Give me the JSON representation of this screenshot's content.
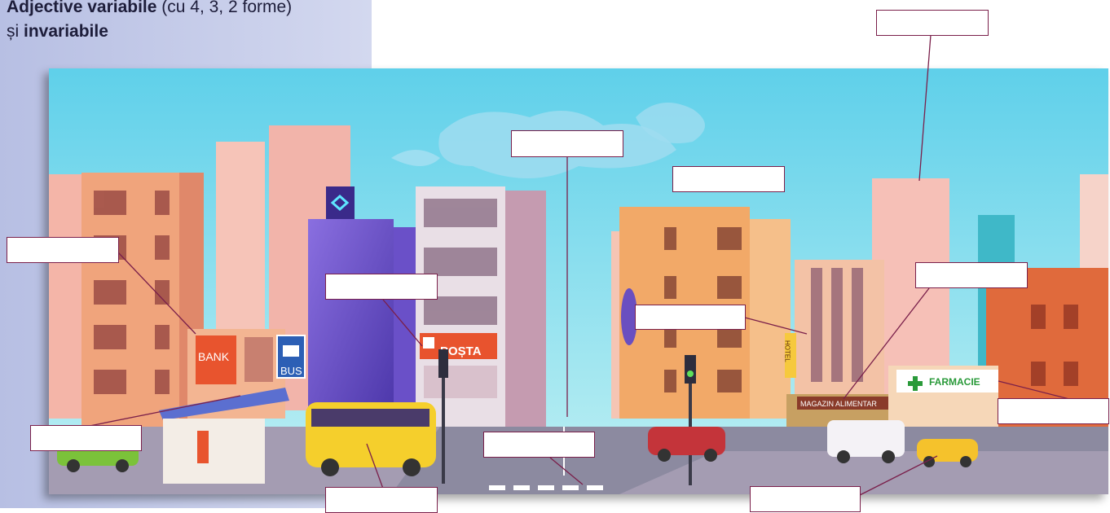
{
  "heading": {
    "part1": "Adjective variabile",
    "part2": " (cu 4, 3, 2 forme)",
    "part3": "și ",
    "part4": "invariabile"
  },
  "signs": {
    "bank": "BANK",
    "bus": "BUS",
    "posta": "POȘTA",
    "hotel": "HOTEL",
    "magazin": "MAGAZIN ALIMENTAR",
    "farmacie": "FARMACIE"
  },
  "answer_boxes": [
    "",
    "",
    "",
    "",
    "",
    "",
    "",
    "",
    "",
    "",
    ""
  ]
}
